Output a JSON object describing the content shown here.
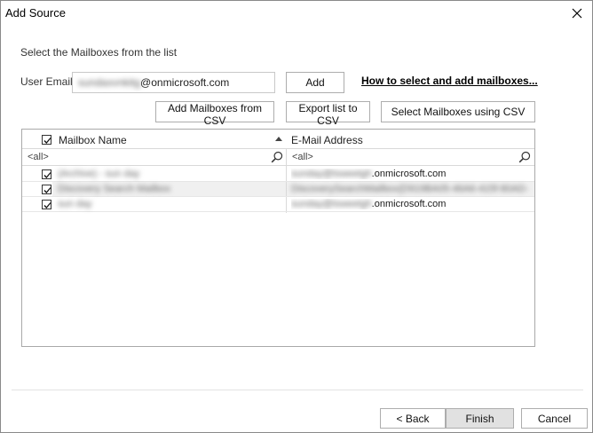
{
  "window": {
    "title": "Add Source"
  },
  "form": {
    "instruction": "Select the Mailboxes from the list",
    "email_label": "User Email",
    "email_user_redacted": "sundaxvnkitg",
    "email_domain": "@onmicrosoft.com",
    "add_label": "Add",
    "help_link": "How to select and add mailboxes..."
  },
  "toolbar": {
    "add_csv": "Add Mailboxes from CSV",
    "export_csv": "Export list to CSV",
    "select_csv": "Select Mailboxes using CSV"
  },
  "grid": {
    "columns": [
      "Mailbox Name",
      "E-Mail Address"
    ],
    "filter_placeholder": "<all>",
    "rows": [
      {
        "name": "(Archive) - sun day",
        "email_user": "sunday@tsweetgh",
        "email_domain": ".onmicrosoft.com",
        "checked": true
      },
      {
        "name": "Discovery Search Mailbox",
        "email_user": "DiscoverySearchMailbox{D919BA05-46A6-415f-80AD-",
        "email_domain": "",
        "checked": true
      },
      {
        "name": "sun day",
        "email_user": "sunday@tsweetgh",
        "email_domain": ".onmicrosoft.com",
        "checked": true
      }
    ]
  },
  "footer": {
    "back": "< Back",
    "finish": "Finish",
    "cancel": "Cancel"
  }
}
